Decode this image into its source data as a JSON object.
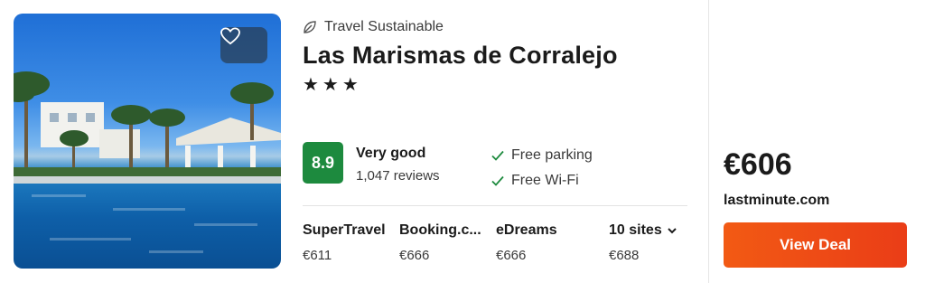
{
  "hotel": {
    "sustainability_label": "Travel Sustainable",
    "name": "Las Marismas de Corralejo",
    "stars": "★★★",
    "star_count": 3
  },
  "rating": {
    "score": "8.9",
    "label": "Very good",
    "reviews": "1,047 reviews",
    "color": "#1d8a3e"
  },
  "amenities": [
    {
      "label": "Free parking"
    },
    {
      "label": "Free Wi-Fi"
    }
  ],
  "sites": [
    {
      "name": "SuperTravel",
      "price": "€611"
    },
    {
      "name": "Booking.c...",
      "price": "€666"
    },
    {
      "name": "eDreams",
      "price": "€666"
    }
  ],
  "more_sites": {
    "label": "10 sites",
    "price": "€688"
  },
  "deal": {
    "price": "€606",
    "provider": "lastminute.com",
    "button_label": "View Deal",
    "button_color": "#f25a14"
  },
  "icons": {
    "favorite": "heart-outline-icon",
    "sustainable": "leaf-icon",
    "amenity_check": "check-icon",
    "expand": "chevron-down-icon"
  }
}
